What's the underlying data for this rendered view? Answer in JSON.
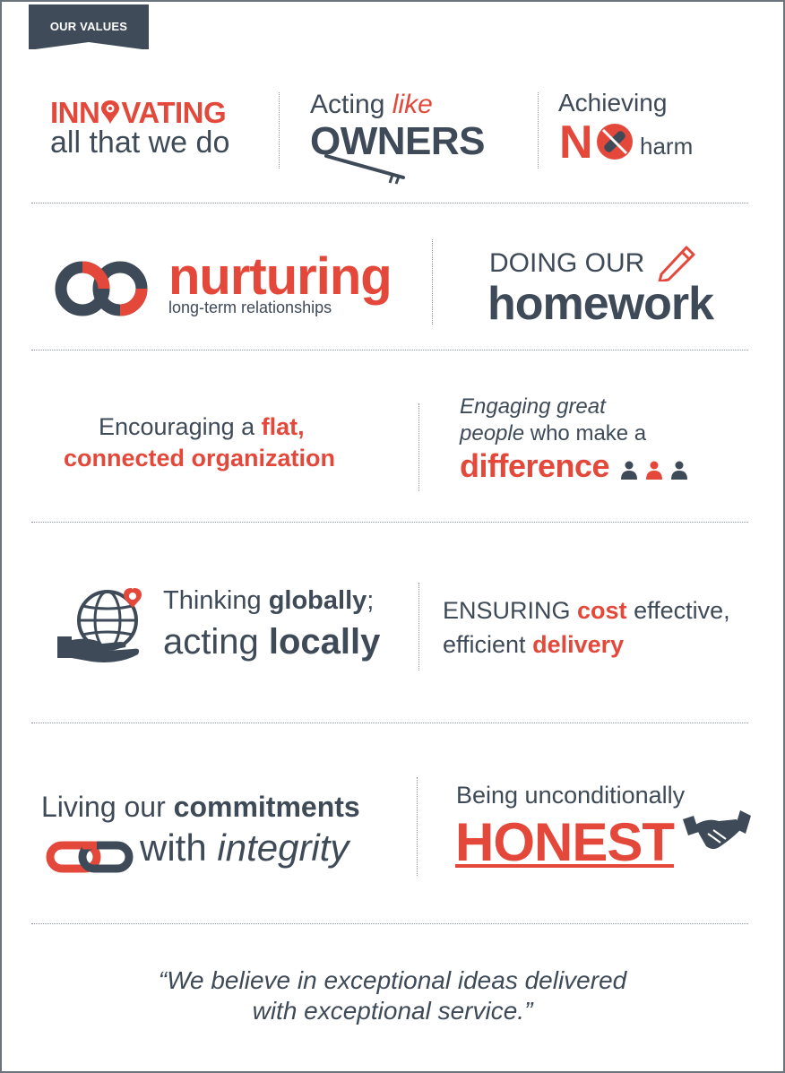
{
  "header": {
    "tag_label": "OUR VALUES"
  },
  "values": {
    "innovating": {
      "word_pre": "INN",
      "word_post": "VATING",
      "line2": "all that we do"
    },
    "owners": {
      "acting": "Acting",
      "like": "like",
      "word_pre": "O",
      "word_post": "WNERS"
    },
    "no_harm": {
      "achieving": "Achieving",
      "no": "N",
      "harm": "harm"
    },
    "nurturing": {
      "word": "nurturing",
      "sub": "long-term relationships"
    },
    "homework": {
      "line1": "DOING OUR",
      "line2": "homework"
    },
    "flat": {
      "pre": "Encouraging a",
      "bold1": "flat,",
      "bold2": "connected organization"
    },
    "engaging": {
      "line1": "Engaging great",
      "people": "people",
      "who_make": "who make a",
      "difference": "difference"
    },
    "globally": {
      "thinking": "Thinking",
      "globally": "globally",
      "semi": ";",
      "acting": "acting",
      "locally": "locally"
    },
    "cost": {
      "ensuring": "ENSURING",
      "cost": "cost",
      "effective": "effective,",
      "efficient": "efficient",
      "delivery": "delivery"
    },
    "commitments": {
      "living": "Living our",
      "commitments": "commitments",
      "with": "with",
      "integrity": "integrity"
    },
    "honest": {
      "being": "Being unconditionally",
      "word": "HONEST"
    }
  },
  "quote": {
    "line1": "“We believe in exceptional ideas delivered",
    "line2": "with exceptional service.”"
  },
  "colors": {
    "accent": "#e3483a",
    "dark": "#3e4a57",
    "tag_bg": "#3f4b58"
  },
  "icons": [
    "lightbulb-gear-icon",
    "key-icon",
    "no-bandage-icon",
    "infinity-icon",
    "pencil-icon",
    "people-icon",
    "globe-hand-icon",
    "chain-link-icon",
    "handshake-icon"
  ]
}
